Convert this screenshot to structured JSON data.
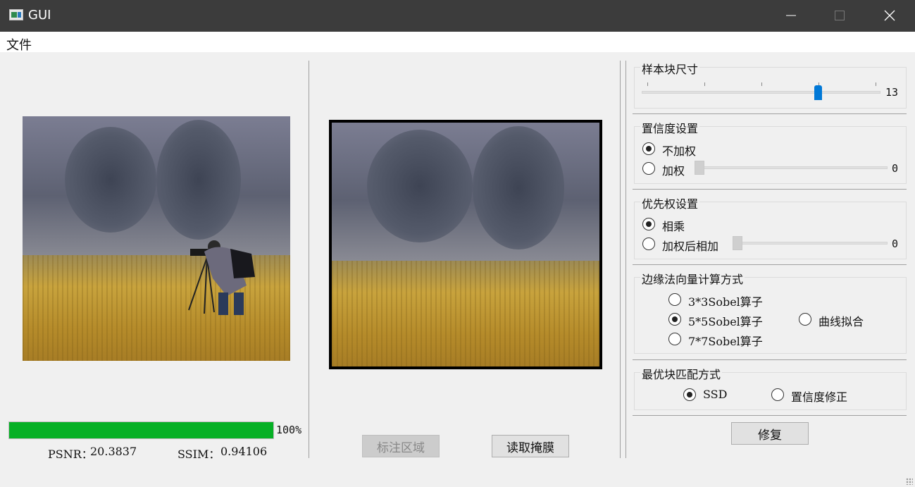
{
  "window": {
    "title": "GUI"
  },
  "menu": {
    "items": [
      "文件"
    ]
  },
  "left_panel": {
    "progress": {
      "value": 1.0,
      "label": "100%"
    },
    "psnr": {
      "label": "PSNR：",
      "value": "20.3837"
    },
    "ssim": {
      "label": "SSIM：",
      "value": "0.94106"
    }
  },
  "middle_panel": {
    "buttons": {
      "mark_region": "标注区域",
      "read_mask": "读取掩膜"
    }
  },
  "right_panel": {
    "patch_size": {
      "title": "样本块尺寸",
      "value": "13"
    },
    "confidence": {
      "title": "置信度设置",
      "options": [
        {
          "label": "不加权",
          "checked": true
        },
        {
          "label": "加权",
          "checked": false,
          "slider_value": "0"
        }
      ]
    },
    "priority": {
      "title": "优先权设置",
      "options": [
        {
          "label": "相乘",
          "checked": true
        },
        {
          "label": "加权后相加",
          "checked": false,
          "slider_value": "0"
        }
      ]
    },
    "normal": {
      "title": "边缘法向量计算方式",
      "options": [
        {
          "label": "3*3Sobel算子",
          "checked": false
        },
        {
          "label": "5*5Sobel算子",
          "checked": true
        },
        {
          "label": "7*7Sobel算子",
          "checked": false
        },
        {
          "label": "曲线拟合",
          "checked": false
        }
      ]
    },
    "match": {
      "title": "最优块匹配方式",
      "options": [
        {
          "label": "SSD",
          "checked": true
        },
        {
          "label": "置信度修正",
          "checked": false
        }
      ]
    },
    "repair_button": "修复"
  },
  "colors": {
    "progress": "#06b025",
    "slider_accent": "#0078d7",
    "titlebar": "#3c3c3c"
  }
}
